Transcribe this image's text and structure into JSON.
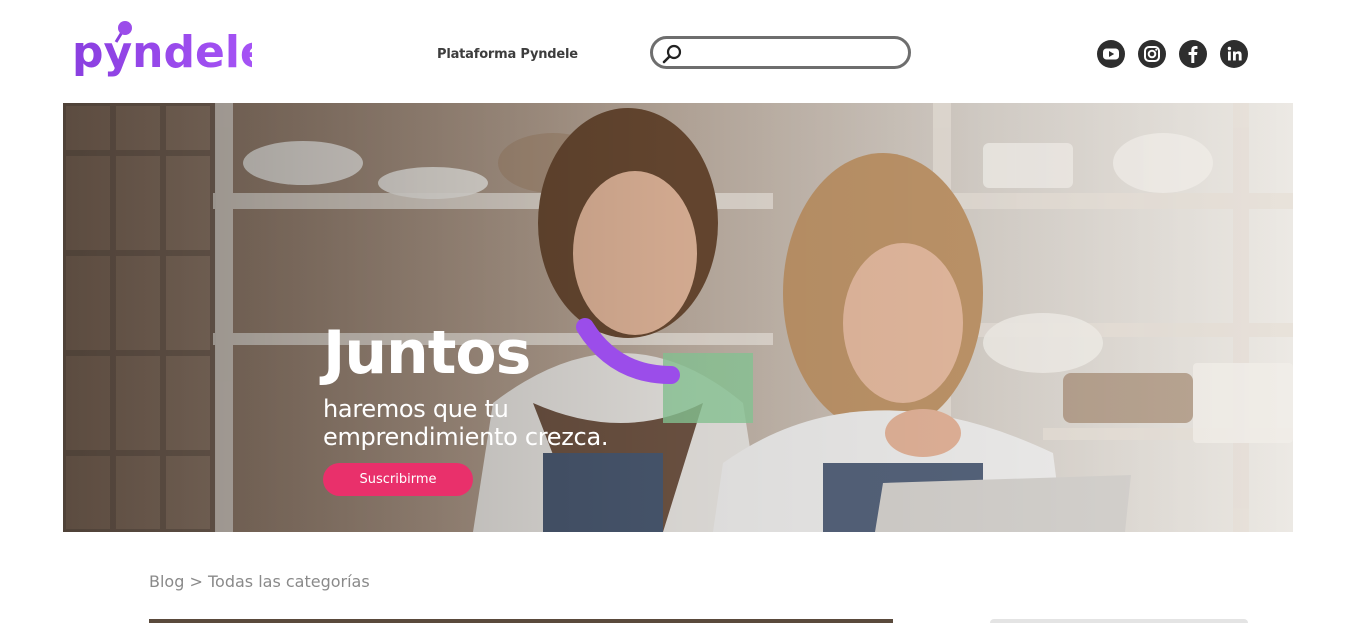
{
  "brand": {
    "logo_text": "pyndele",
    "accent_color": "#9b4dea",
    "cta_color": "#e9306b"
  },
  "header": {
    "nav_link": "Plataforma Pyndele",
    "search": {
      "value": "",
      "placeholder": "",
      "icon": "search-icon"
    },
    "social": [
      {
        "name": "youtube",
        "icon": "youtube-icon"
      },
      {
        "name": "instagram",
        "icon": "instagram-icon"
      },
      {
        "name": "facebook",
        "icon": "facebook-icon"
      },
      {
        "name": "linkedin",
        "icon": "linkedin-icon"
      }
    ]
  },
  "hero": {
    "title": "Juntos",
    "subtitle_line1": "haremos que tu",
    "subtitle_line2": "emprendimiento crezca.",
    "cta_label": "Suscribirme"
  },
  "breadcrumb": {
    "root": "Blog",
    "separator": ">",
    "current": "Todas las categorías"
  }
}
